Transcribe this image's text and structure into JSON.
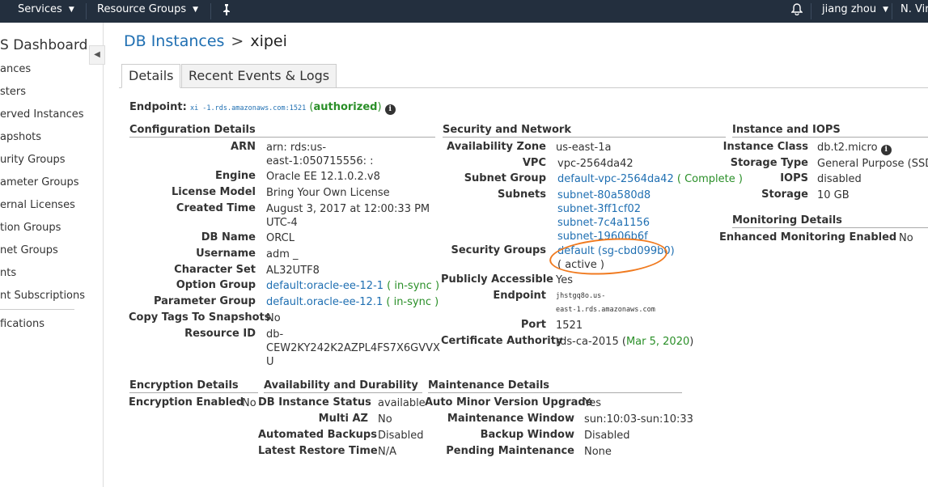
{
  "topbar": {
    "services": "Services",
    "resource_groups": "Resource Groups",
    "user": "jiang zhou",
    "region": "N. Vir"
  },
  "sidebar": {
    "title": "S Dashboard",
    "items": [
      "ances",
      "sters",
      "erved Instances",
      "apshots",
      "urity Groups",
      "ameter Groups",
      "ernal Licenses",
      "tion Groups",
      "net Groups",
      "nts",
      "nt Subscriptions",
      "fications"
    ]
  },
  "breadcrumb": {
    "parent": "DB Instances",
    "separator": ">",
    "current": "xipei"
  },
  "tabs": [
    "Details",
    "Recent Events & Logs"
  ],
  "endpoint": {
    "label": "Endpoint:",
    "value": "xi          -1.rds.amazonaws.com:1521",
    "open": "(",
    "status": "authorized",
    "close": ")"
  },
  "config": {
    "title": "Configuration Details",
    "arn_label": "ARN",
    "arn_line1": "arn:       rds:us-",
    "arn_line2": "east-1:050715556:          :",
    "engine_label": "Engine",
    "engine": "Oracle EE 12.1.0.2.v8",
    "license_label": "License Model",
    "license": "Bring Your Own License",
    "created_label": "Created Time",
    "created_line1": "August 3, 2017 at 12:00:33 PM",
    "created_line2": "UTC-4",
    "dbname_label": "DB Name",
    "dbname": "ORCL",
    "username_label": "Username",
    "username": "adm    _",
    "charset_label": "Character Set",
    "charset": "AL32UTF8",
    "optgroup_label": "Option Group",
    "optgroup": "default:oracle-ee-12-1",
    "paramgroup_label": "Parameter Group",
    "paramgroup": "default.oracle-ee-12.1",
    "insync": "in-sync",
    "open": "(",
    "close": ")",
    "copytags_label": "Copy Tags To Snapshots",
    "copytags": "No",
    "resid_label": "Resource ID",
    "resid_line1": "db-",
    "resid_line2": "CEW2KY242K2AZPL4FS7X6GVVX",
    "resid_line3": "U"
  },
  "security": {
    "title": "Security and Network",
    "az_label": "Availability Zone",
    "az": "us-east-1a",
    "vpc_label": "VPC",
    "vpc": "vpc-2564da42",
    "subnetgroup_label": "Subnet Group",
    "subnetgroup": "default-vpc-2564da42",
    "complete": "Complete",
    "subnets_label": "Subnets",
    "subnets": [
      "subnet-80a580d8",
      "subnet-3ff1cf02",
      "subnet-7c4a1156",
      "subnet-19606b6f"
    ],
    "sg_label": "Security Groups",
    "sg": "default (sg-cbd099b0)",
    "sg_status": "( active )",
    "public_label": "Publicly Accessible",
    "public": "Yes",
    "endpoint_label": "Endpoint",
    "endpoint_line1": "         jhstgq8o.us-",
    "endpoint_line2": "east-1.rds.amazonaws.com",
    "port_label": "Port",
    "port": "1521",
    "ca_label": "Certificate Authority",
    "ca": "rds-ca-2015",
    "ca_date": "Mar 5, 2020"
  },
  "iops": {
    "title": "Instance and IOPS",
    "class_label": "Instance Class",
    "class": "db.t2.micro",
    "storage_type_label": "Storage Type",
    "storage_type": "General Purpose (SSD)",
    "iops_label": "IOPS",
    "iops": "disabled",
    "storage_label": "Storage",
    "storage": "10 GB"
  },
  "monitoring": {
    "title": "Monitoring Details",
    "enhanced_label": "Enhanced Monitoring Enabled",
    "enhanced": "No"
  },
  "encryption": {
    "title": "Encryption Details",
    "enabled_label": "Encryption Enabled",
    "enabled": "No"
  },
  "availability": {
    "title": "Availability and Durability",
    "status_label": "DB Instance Status",
    "status": "available",
    "multiaz_label": "Multi AZ",
    "multiaz": "No",
    "backups_label": "Automated Backups",
    "backups": "Disabled",
    "restore_label": "Latest Restore Time",
    "restore": "N/A"
  },
  "maintenance": {
    "title": "Maintenance Details",
    "minor_label": "Auto Minor Version Upgrade",
    "minor": "Yes",
    "window_label": "Maintenance Window",
    "window": "sun:10:03-sun:10:33",
    "backup_label": "Backup Window",
    "backup": "Disabled",
    "pending_label": "Pending Maintenance",
    "pending": "None"
  }
}
